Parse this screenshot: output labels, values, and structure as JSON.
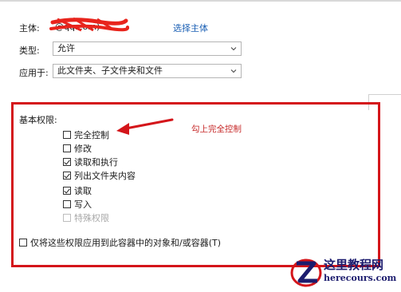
{
  "principal": {
    "label": "主体:",
    "value": "@qq.com)",
    "select_link": "选择主体"
  },
  "type_row": {
    "label": "类型:",
    "value": "允许"
  },
  "applies_row": {
    "label": "应用于:",
    "value": "此文件夹、子文件夹和文件"
  },
  "permissions": {
    "title": "基本权限:",
    "items": [
      {
        "label": "完全控制",
        "checked": false,
        "disabled": false
      },
      {
        "label": "修改",
        "checked": false,
        "disabled": false
      },
      {
        "label": "读取和执行",
        "checked": true,
        "disabled": false
      },
      {
        "label": "列出文件夹内容",
        "checked": true,
        "disabled": false
      },
      {
        "label": "读取",
        "checked": true,
        "disabled": false
      },
      {
        "label": "写入",
        "checked": false,
        "disabled": false
      },
      {
        "label": "特殊权限",
        "checked": false,
        "disabled": true
      }
    ],
    "apply_only": "仅将这些权限应用到此容器中的对象和/或容器(T)"
  },
  "annotation": "勾上完全控制",
  "watermark": {
    "line1": "这里教程网",
    "line2": "herecours.com"
  },
  "colors": {
    "highlight": "#d4151a",
    "link": "#1a5fb4",
    "annotation": "#c62828"
  },
  "icons": [
    "chevron-down-icon",
    "red-arrow-icon",
    "watermark-logo-icon"
  ]
}
